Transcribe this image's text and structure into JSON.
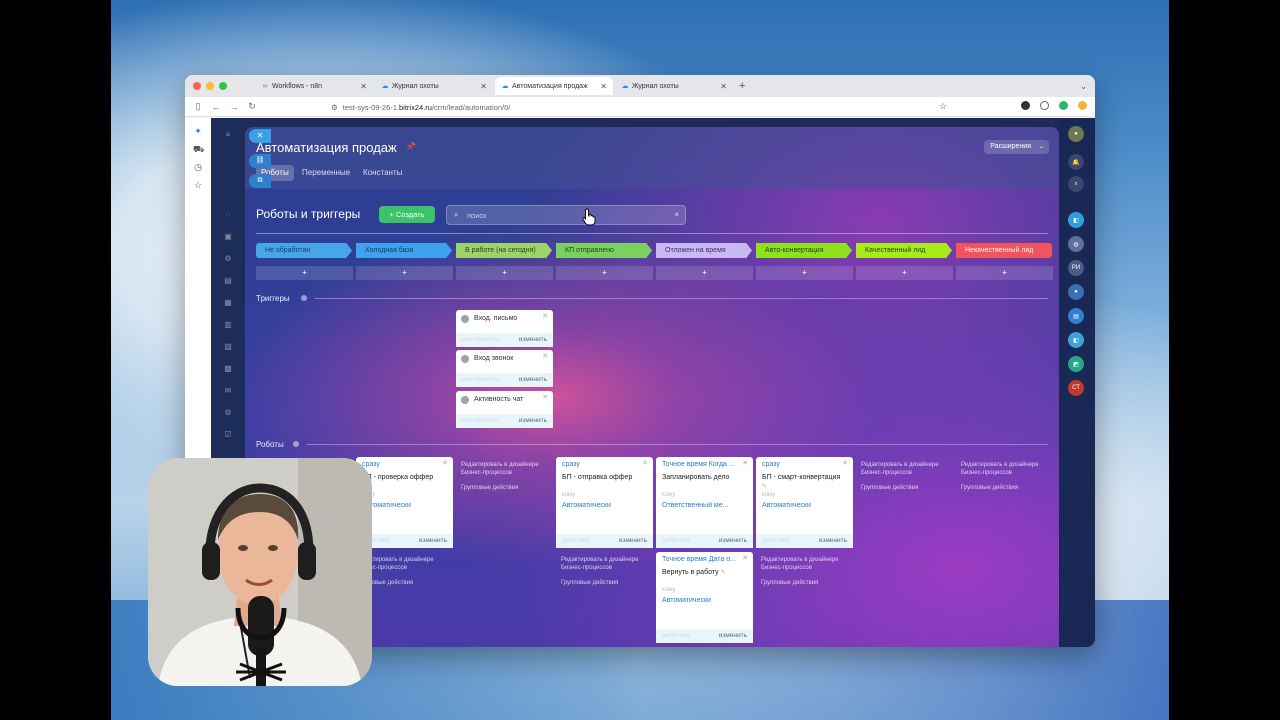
{
  "browser": {
    "tabs": [
      {
        "label": "Workflows - n8n",
        "icon": "n8n-icon"
      },
      {
        "label": "Журнал охоты",
        "icon": "cloud-icon"
      },
      {
        "label": "Автоматизация продаж",
        "icon": "cloud-icon"
      },
      {
        "label": "Журнал охоты",
        "icon": "cloud-icon"
      }
    ],
    "new_tab": "+",
    "url_prefix": "test-sys-09-26-1.",
    "url_host": "bitrix24.ru",
    "url_path": "/crm/lead/automation/0/"
  },
  "slider": {
    "title": "Автоматизация продаж",
    "tabs": [
      "Роботы",
      "Переменные",
      "Константы"
    ],
    "extensions_label": "Расширения"
  },
  "toolbar": {
    "section_title": "Роботы и триггеры",
    "create_label": "+ Создать",
    "search_placeholder": "поиск",
    "search_clear": "×"
  },
  "stages": [
    {
      "label": "Не обработан",
      "color": "#47a6e9",
      "text": "#173a5c"
    },
    {
      "label": "Холодная база",
      "color": "#3fa2ee",
      "text": "#173a5c"
    },
    {
      "label": "В работе (на сегодня)",
      "color": "#9ed26b",
      "text": "#234315"
    },
    {
      "label": "КП отправлено",
      "color": "#7ad15f",
      "text": "#234315"
    },
    {
      "label": "Отложен на время",
      "color": "#c9b9f2",
      "text": "#3b2f60"
    },
    {
      "label": "Авто-конвертация",
      "color": "#8fe01d",
      "text": "#234315"
    },
    {
      "label": "Качественный лид",
      "color": "#a8ea1a",
      "text": "#234315"
    },
    {
      "label": "Некачественный лид",
      "color": "#f2545b",
      "text": "#ffffff"
    }
  ],
  "add_symbol": "+",
  "labels": {
    "triggers": "Триггеры",
    "robots": "Роботы"
  },
  "triggers": [
    {
      "name": "Вход. письмо",
      "copy": "скопировать",
      "edit": "изменить"
    },
    {
      "name": "Вход звонок",
      "copy": "скопировать",
      "edit": "изменить"
    },
    {
      "name": "Активность чат",
      "copy": "скопировать",
      "edit": "изменить"
    }
  ],
  "robots": {
    "r1": {
      "time": "сразу",
      "name": "БП - проверка оффер",
      "who_label": "кому",
      "who": "Автоматически",
      "left": "действия",
      "edit": "изменить"
    },
    "r2": {
      "time": "сразу",
      "name": "БП - отправка оффер",
      "who_label": "кому",
      "who": "Автоматически",
      "left": "действия",
      "edit": "изменить"
    },
    "r3": {
      "time": "Точное время Когда ...",
      "name": "Запланировать дело",
      "who_label": "кому",
      "who": "Ответственный ме...",
      "left": "действия",
      "edit": "изменить"
    },
    "r4": {
      "time": "Точное время Дата о...",
      "name": "Вернуть в работу",
      "who_label": "кому",
      "who": "Автоматически",
      "left": "действия",
      "edit": "изменить"
    },
    "r5": {
      "time": "сразу",
      "name": "БП - смарт-конвертация",
      "who_label": "кому",
      "who": "Автоматически",
      "left": "действия",
      "edit": "изменить"
    }
  },
  "links": {
    "designer": "Редактировать в дизайнере Бизнес-процессов",
    "group": "Групповые действия"
  },
  "right_sidebar": {
    "initials_1": "РИ",
    "initials_2": "СТ"
  }
}
